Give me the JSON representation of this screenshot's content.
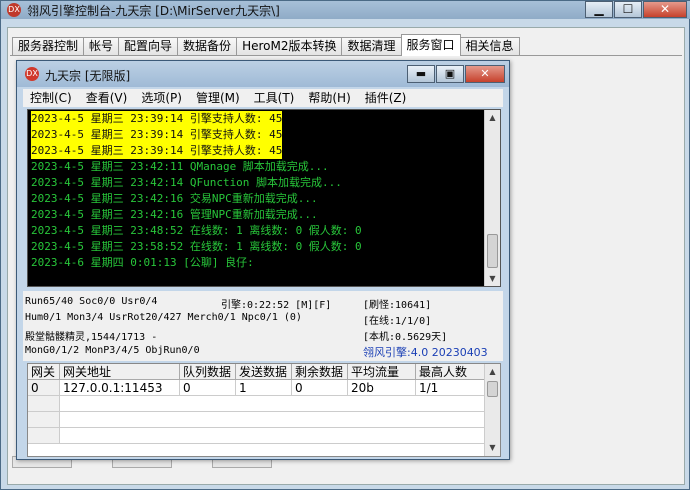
{
  "outer_window": {
    "icon": "DX",
    "title": "翎风引擎控制台-九天宗 [D:\\MirServer九天宗\\]",
    "buttons": {
      "minimize": "▁",
      "maximize": "☐",
      "close": "✕"
    }
  },
  "tabs": [
    {
      "label": "服务器控制",
      "active": false
    },
    {
      "label": "帐号",
      "active": false
    },
    {
      "label": "配置向导",
      "active": false
    },
    {
      "label": "数据备份",
      "active": false
    },
    {
      "label": "HeroM2版本转换",
      "active": false
    },
    {
      "label": "数据清理",
      "active": false
    },
    {
      "label": "服务窗口",
      "active": true
    },
    {
      "label": "相关信息",
      "active": false
    }
  ],
  "inner_window": {
    "icon": "DX",
    "title": "九天宗 [无限版]",
    "buttons": {
      "minimize": "▬",
      "maximize": "▣",
      "close": "✕"
    }
  },
  "menus": [
    "控制(C)",
    "查看(V)",
    "选项(P)",
    "管理(M)",
    "工具(T)",
    "帮助(H)",
    "插件(Z)"
  ],
  "console": {
    "lines": [
      {
        "text": "2023-4-5 星期三 23:39:14 引擎支持人数: 45",
        "style": "hl"
      },
      {
        "text": "2023-4-5 星期三 23:39:14 引擎支持人数: 45",
        "style": "hl"
      },
      {
        "text": "2023-4-5 星期三 23:39:14 引擎支持人数: 45",
        "style": "hl"
      },
      {
        "text": "2023-4-5 星期三 23:42:11 QManage 脚本加载完成...",
        "style": "ok"
      },
      {
        "text": "2023-4-5 星期三 23:42:14 QFunction 脚本加载完成...",
        "style": "ok"
      },
      {
        "text": "2023-4-5 星期三 23:42:16 交易NPC重新加载完成...",
        "style": "ok"
      },
      {
        "text": "2023-4-5 星期三 23:42:16 管理NPC重新加载完成...",
        "style": "ok"
      },
      {
        "text": "2023-4-5 星期三 23:48:52 在线数: 1 离线数: 0 假人数: 0",
        "style": "ok"
      },
      {
        "text": "2023-4-5 星期三 23:58:52 在线数: 1 离线数: 0 假人数: 0",
        "style": "ok"
      },
      {
        "text": "2023-4-6 星期四 0:01:13 [公聊] 良仔:",
        "style": "ok"
      }
    ],
    "scroll_up": "▲",
    "scroll_down": "▼"
  },
  "status": {
    "line1_left": "Run65/40 Soc0/0 Usr0/4",
    "line1_mid": "引擎:0:22:52 [M][F]",
    "line1_right": "[刷怪:10641]",
    "line2_left": "Hum0/1 Mon3/4 UsrRot20/427 Merch0/1 Npc0/1 (0)",
    "line2_right": "[在线:1/1/0]",
    "line3_left": "殿堂骷髅精灵,1544/1713 -",
    "line3_right": "[本机:0.5629天]",
    "line4_left": "MonG0/1/2 MonP3/4/5 ObjRun0/0",
    "version": "翎风引擎:4.0 20230403",
    "version_color": "#1a3fb5"
  },
  "gateway_table": {
    "headers": [
      "网关",
      "网关地址",
      "队列数据",
      "发送数据",
      "剩余数据",
      "平均流量",
      "最高人数"
    ],
    "rows": [
      [
        "0",
        "127.0.0.1:11453",
        "0",
        "1",
        "0",
        "20b",
        "1/1"
      ]
    ],
    "scroll_up": "▲",
    "scroll_down": "▼"
  }
}
